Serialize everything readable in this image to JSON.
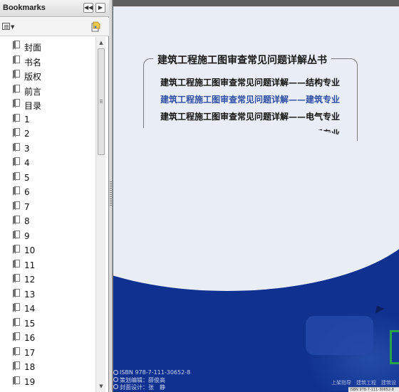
{
  "panel": {
    "title": "Bookmarks",
    "btn_collapse_icon": "double-left-icon",
    "btn_close_icon": "right-triangle-icon"
  },
  "bookmarks": [
    "封面",
    "书名",
    "版权",
    "前言",
    "目录",
    "1",
    "2",
    "3",
    "4",
    "5",
    "6",
    "7",
    "8",
    "9",
    "10",
    "11",
    "12",
    "13",
    "14",
    "15",
    "16",
    "17",
    "18",
    "19"
  ],
  "document": {
    "series_title": "建筑工程施工图审查常见问题详解丛书",
    "series_lines": [
      "建筑工程施工图审查常见问题详解——结构专业",
      "建筑工程施工图审查常见问题详解——建筑专业",
      "建筑工程施工图审查常见问题详解——电气专业",
      "建筑工程施工图审查常见问题详解——水暖专业"
    ],
    "active_line_index": 1,
    "info_lines": [
      "ISBN 978-7-111-30652-8",
      "策划编辑：薛俊高",
      "封面设计：张　静"
    ],
    "bottom_small": "上架指导　建筑工程　建筑设",
    "barcode_text": "ISBN 978-7-111-30652-8",
    "colors": {
      "cover_blue": "#10318f",
      "page_bg": "#e9eef6",
      "active_line": "#2f4ea3",
      "accent_green": "#27a34a"
    }
  }
}
